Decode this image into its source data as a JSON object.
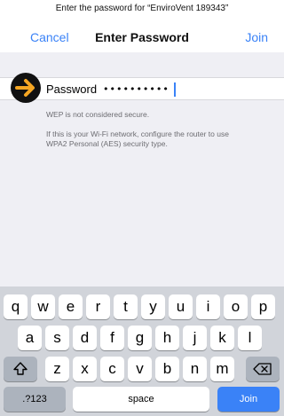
{
  "prompt": "Enter the password for “EnviroVent 189343”",
  "nav": {
    "cancel": "Cancel",
    "title": "Enter Password",
    "join": "Join"
  },
  "password_field": {
    "label": "Password",
    "value": "••••••••••"
  },
  "notes": {
    "wep": "WEP is not considered secure.",
    "advice_line1": "If this is your Wi-Fi network, configure the router to use",
    "advice_line2": "WPA2 Personal (AES) security type."
  },
  "keyboard": {
    "row1": [
      "q",
      "w",
      "e",
      "r",
      "t",
      "y",
      "u",
      "i",
      "o",
      "p"
    ],
    "row2": [
      "a",
      "s",
      "d",
      "f",
      "g",
      "h",
      "j",
      "k",
      "l"
    ],
    "row3": [
      "z",
      "x",
      "c",
      "v",
      "b",
      "n",
      "m"
    ],
    "mode_key": ".?123",
    "space_key": "space",
    "join_key": "Join",
    "shift_icon": "shift-icon",
    "backspace_icon": "backspace-icon"
  },
  "colors": {
    "accent": "#3a82f7",
    "arrow": "#f5a623"
  }
}
